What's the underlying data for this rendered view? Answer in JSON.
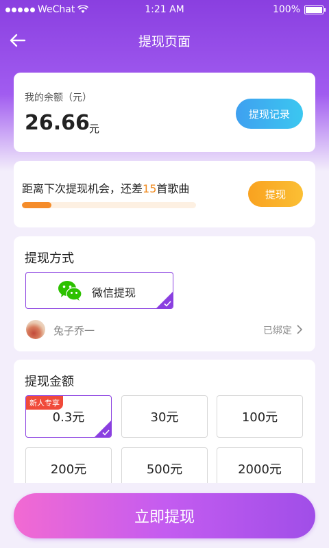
{
  "status_bar": {
    "carrier": "WeChat",
    "time": "1:21 AM",
    "battery": "100%"
  },
  "nav": {
    "title": "提现页面",
    "back_icon": "back-arrow-icon"
  },
  "balance": {
    "label": "我的余额（元）",
    "value": "26.66",
    "unit": "元",
    "record_button": "提现记录"
  },
  "chance": {
    "prefix": "距离下次提现机会，还差",
    "count": "15",
    "suffix": "首歌曲",
    "button": "提现",
    "progress": 0.17
  },
  "method": {
    "title": "提现方式",
    "option_label": "微信提现",
    "option_icon": "wechat-icon",
    "account_name": "兔子乔一",
    "bound_label": "已绑定"
  },
  "amounts": {
    "title": "提现金额",
    "new_badge": "新人专享",
    "options": [
      "0.3元",
      "30元",
      "100元",
      "200元",
      "500元",
      "2000元"
    ],
    "selected_index": 0
  },
  "submit": {
    "label": "立即提现"
  },
  "colors": {
    "brand_purple": "#8a3fe0",
    "accent_orange": "#f08a1e",
    "blue": "#3fa0f0"
  }
}
